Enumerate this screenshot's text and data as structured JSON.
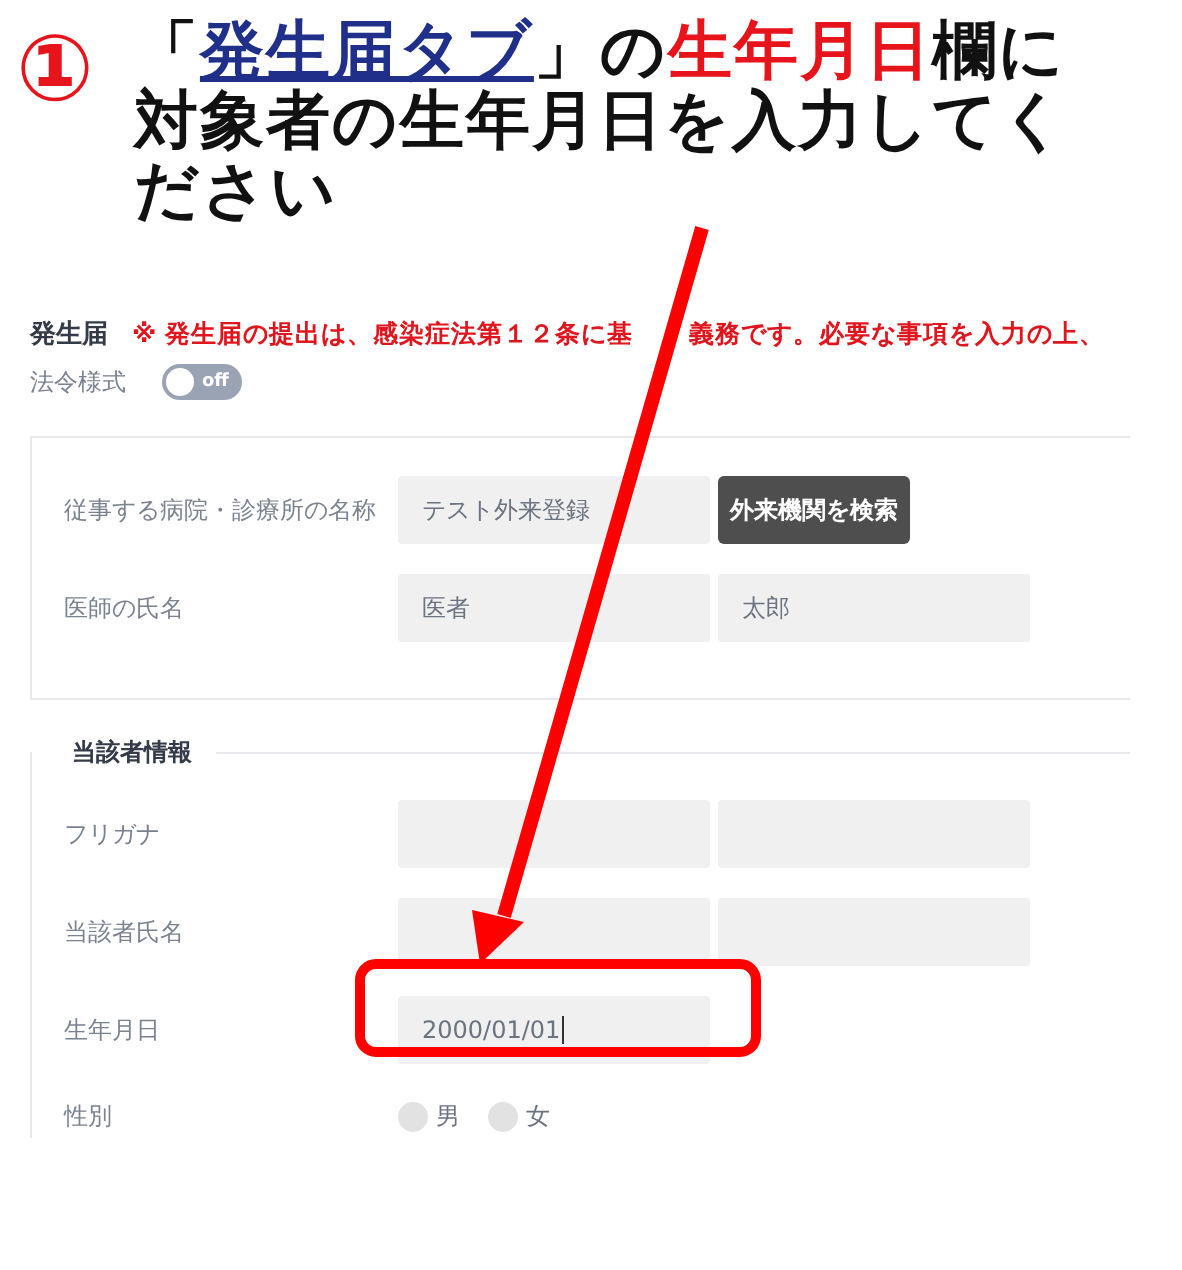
{
  "step_number": "①",
  "instruction_lines": [
    [
      {
        "kind": "plain",
        "text": "「"
      },
      {
        "kind": "link",
        "text": "発生届タブ"
      },
      {
        "kind": "plain",
        "text": "」の"
      },
      {
        "kind": "highlight",
        "text": "生年月日"
      },
      {
        "kind": "plain",
        "text": "欄に"
      }
    ],
    [
      {
        "kind": "plain",
        "text": "対象者の生年月日を入力してく"
      }
    ],
    [
      {
        "kind": "plain",
        "text": "ださい"
      }
    ]
  ],
  "form": {
    "title": "発生届",
    "notice": [
      "※ 発生届の提出は、感染症法第１２条に基",
      "義務です。必要な事項を入力の上、"
    ],
    "toggle": {
      "label": "法令様式",
      "on": false,
      "text": "off"
    },
    "facility_section": {
      "rows": [
        {
          "label": "従事する病院・診療所の名称",
          "fields": [
            {
              "kind": "input",
              "value": "テスト外来登録",
              "focused": false
            },
            {
              "kind": "button",
              "text": "外来機関を検索"
            }
          ]
        },
        {
          "label": "医師の氏名",
          "fields": [
            {
              "kind": "input",
              "value": "医者",
              "focused": false
            },
            {
              "kind": "input",
              "value": "太郎",
              "focused": false
            }
          ]
        }
      ]
    },
    "subject_section": {
      "legend": "当該者情報",
      "rows": [
        {
          "label": "フリガナ",
          "fields": [
            {
              "kind": "input",
              "focused": false
            },
            {
              "kind": "input",
              "focused": false
            }
          ]
        },
        {
          "label": "当該者氏名",
          "fields": [
            {
              "kind": "input",
              "focused": false
            },
            {
              "kind": "input",
              "focused": false
            }
          ]
        },
        {
          "label": "生年月日",
          "fields": [
            {
              "kind": "input",
              "value": "2000/01/01",
              "focused": true
            }
          ]
        },
        {
          "label": "性別",
          "fields": [
            {
              "kind": "radio",
              "label": "男",
              "selected": false
            },
            {
              "kind": "radio",
              "label": "女",
              "selected": false
            }
          ]
        }
      ]
    }
  }
}
